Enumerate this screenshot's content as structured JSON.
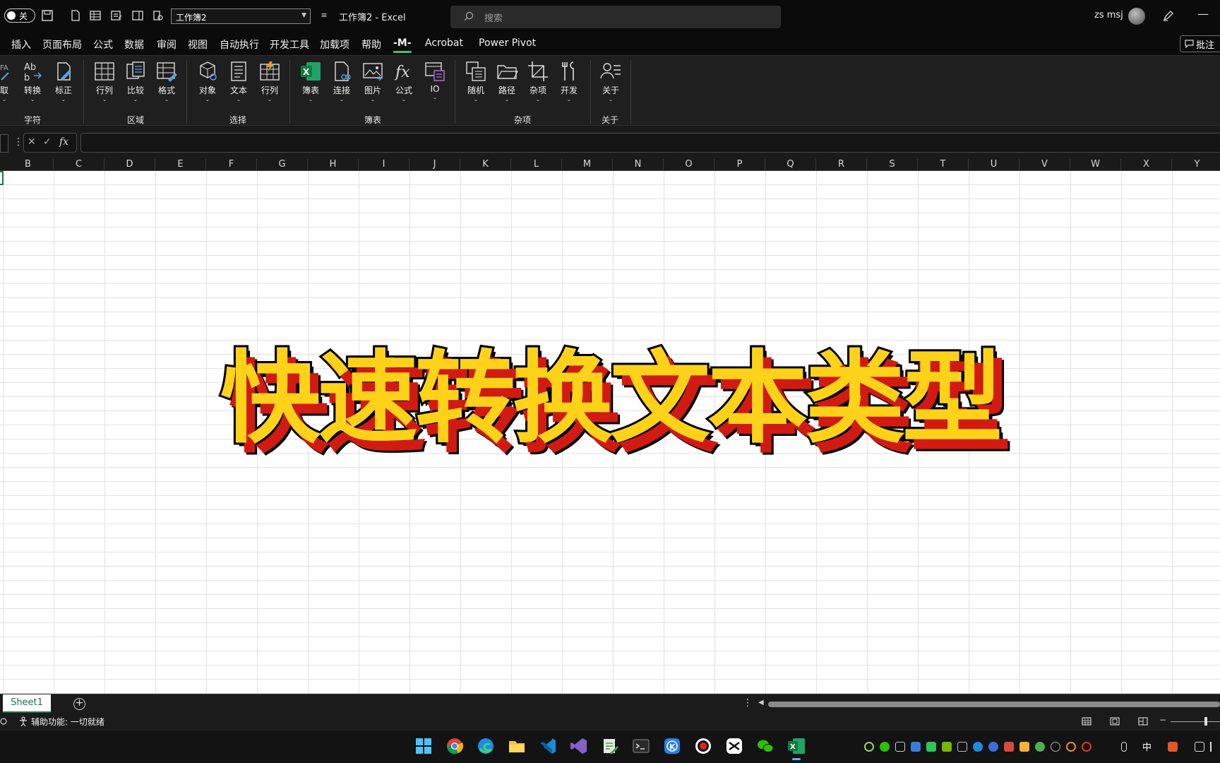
{
  "titlebar": {
    "autosave_label": "关",
    "file_select": "工作簿2",
    "doc_title": "工作簿2  -  Excel",
    "search_placeholder": "搜索",
    "user_name": "zs msj",
    "minimize": "—"
  },
  "menu": {
    "tabs": [
      "插入",
      "页面布局",
      "公式",
      "数据",
      "审阅",
      "视图",
      "自动执行",
      "开发工具",
      "加载项",
      "帮助",
      "-M-",
      "Acrobat",
      "Power Pivot"
    ],
    "active_tab": "-M-",
    "comment_button": "批注"
  },
  "ribbon": {
    "groups": [
      {
        "label": "字符",
        "buttons": [
          "取",
          "转换",
          "标正"
        ]
      },
      {
        "label": "区域",
        "buttons": [
          "行列",
          "比较",
          "格式"
        ]
      },
      {
        "label": "选择",
        "buttons": [
          "对象",
          "文本",
          "行列"
        ]
      },
      {
        "label": "簿表",
        "buttons": [
          "簿表",
          "连接",
          "图片",
          "公式",
          "IO"
        ]
      },
      {
        "label": "杂项",
        "buttons": [
          "随机",
          "路径",
          "杂项",
          "开发"
        ]
      },
      {
        "label": "关于",
        "buttons": [
          "关于"
        ]
      }
    ]
  },
  "formula_bar": {
    "dots": "⋮",
    "fx": "fx",
    "value": ""
  },
  "columns": [
    "B",
    "C",
    "D",
    "E",
    "F",
    "G",
    "H",
    "I",
    "J",
    "K",
    "L",
    "M",
    "N",
    "O",
    "P",
    "Q",
    "R",
    "S",
    "T",
    "U",
    "V",
    "W",
    "X",
    "Y"
  ],
  "overlay_title": "快速转换文本类型",
  "sheets": {
    "tabs": [
      "Sheet1"
    ],
    "add": "+",
    "more": "⋮"
  },
  "status": {
    "accessibility": "辅助功能: 一切就绪"
  },
  "taskbar": {
    "apps": [
      "windows-start",
      "chrome",
      "edge",
      "file-explorer",
      "vscode",
      "visual-studio",
      "notepad",
      "terminal",
      "kugou",
      "recorder",
      "capcut",
      "wechat",
      "excel"
    ],
    "ime": "中"
  },
  "colors": {
    "accent_green": "#1e7145",
    "title_fill": "#ffd21a",
    "title_shadow": "#d11a12"
  }
}
